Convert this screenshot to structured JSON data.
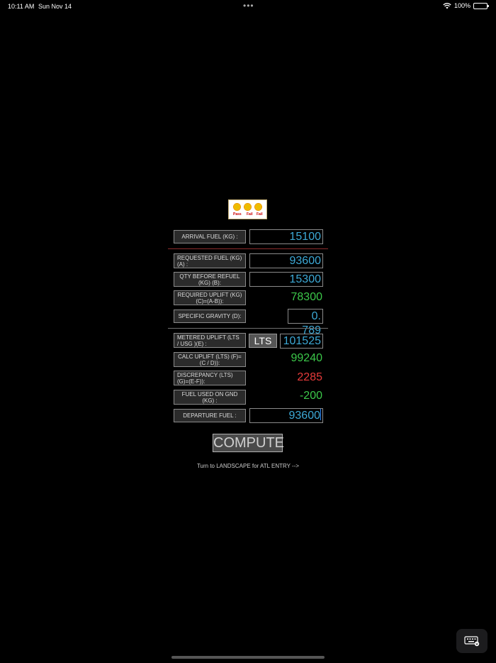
{
  "status_bar": {
    "time": "10:11 AM",
    "date": "Sun Nov 14",
    "battery": "100%"
  },
  "logo": {
    "labels": [
      "Pass",
      "Fail",
      "Fail"
    ]
  },
  "arrival": {
    "label": "ARRIVAL FUEL (KG) :",
    "value": "15100"
  },
  "requested": {
    "label": "REQUESTED FUEL (KG) (A) :",
    "value": "93600"
  },
  "qty_before": {
    "label": "QTY BEFORE REFUEL (KG) (B):",
    "value": "15300"
  },
  "required_uplift": {
    "label": "REQUIRED UPLIFT (KG) (C)=(A-B)):",
    "value": "78300"
  },
  "specific_gravity": {
    "label": "SPECIFIC GRAVITY (D):",
    "value": "0. 789"
  },
  "metered_uplift": {
    "label": "METERED UPLIFT (LTS / USG )(E) :",
    "unit_button": "LTS",
    "value": "101525"
  },
  "calc_uplift": {
    "label": "CALC UPLIFT (LTS) (F)=(C / D)):",
    "value": "99240"
  },
  "discrepancy": {
    "label": "DISCREPANCY (LTS) (G)=(E-F)):",
    "value": "2285"
  },
  "fuel_used": {
    "label": "FUEL USED ON GND (KG) :",
    "value": "-200"
  },
  "departure": {
    "label": "DEPARTURE FUEL :",
    "value": "93600"
  },
  "compute_button": "COMPUTE",
  "hint": "Turn to LANDSCAPE for ATL ENTRY -->",
  "colors": {
    "input_text": "#3da9d6",
    "computed_ok": "#3cc84a",
    "computed_alert": "#e83b3b",
    "divider": "#8b2b2b"
  }
}
